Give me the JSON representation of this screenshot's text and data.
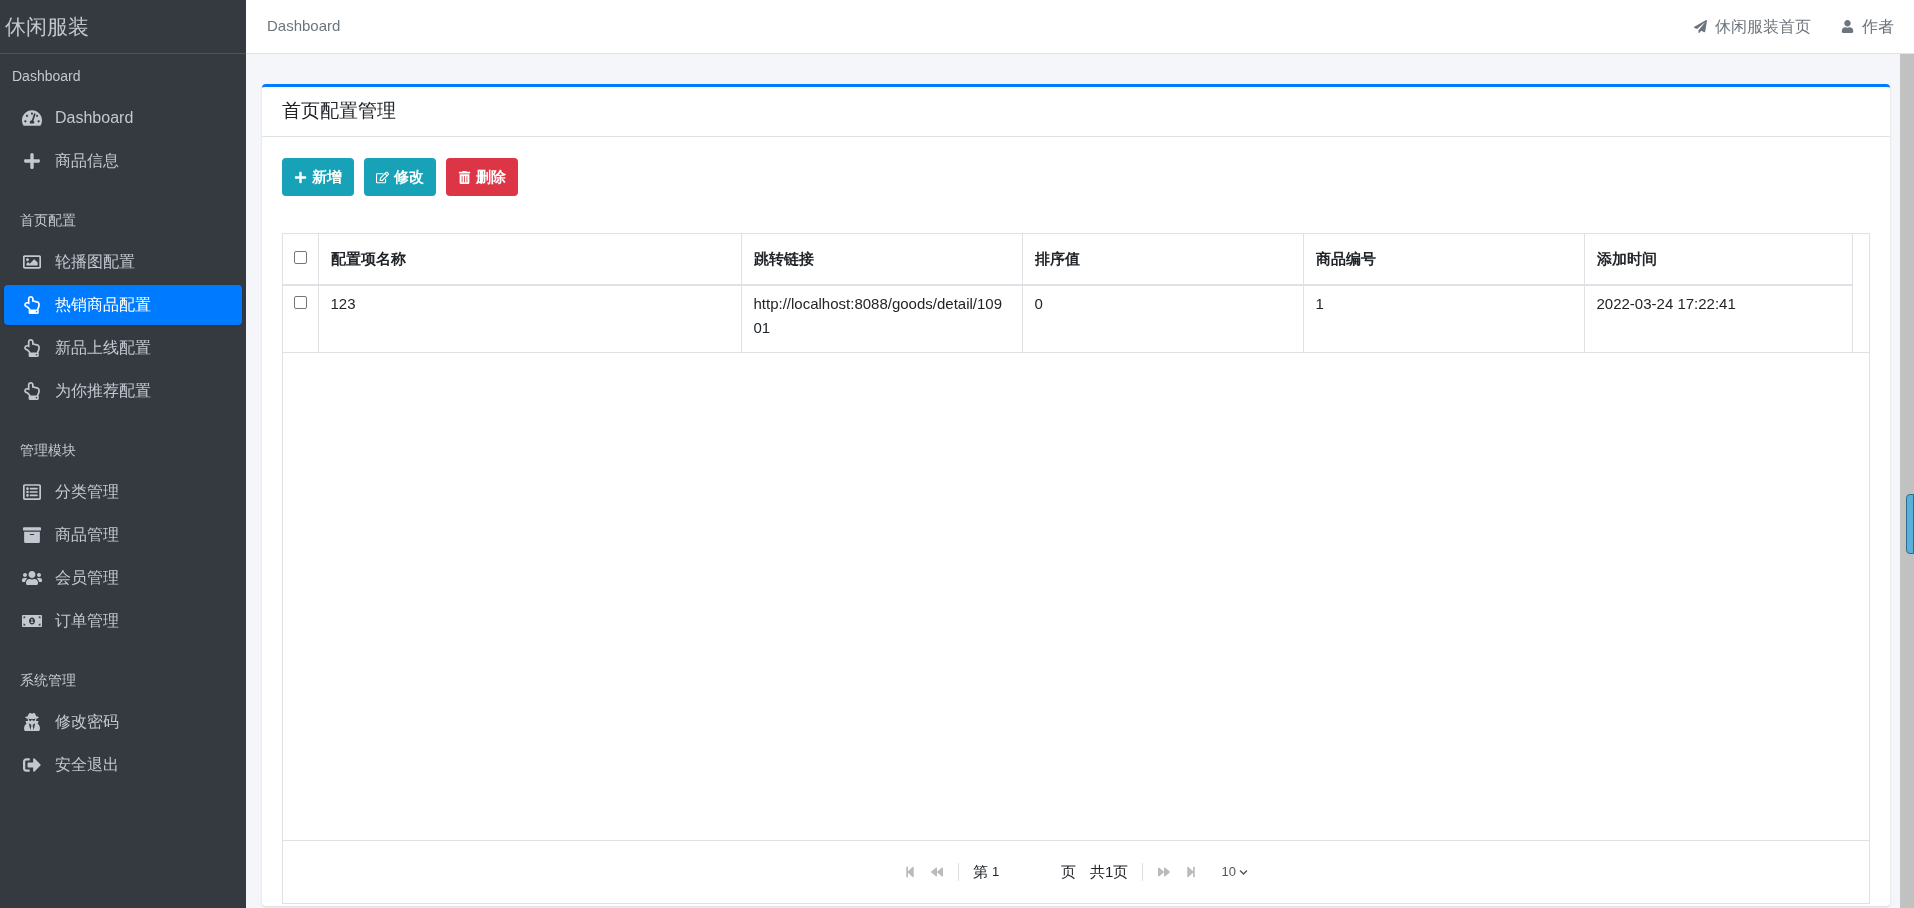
{
  "brand": "休闲服装",
  "sidebar": {
    "sections": [
      {
        "header": "Dashboard",
        "items": [
          {
            "label": "Dashboard",
            "kind": "gauge",
            "selected": false
          },
          {
            "label": "商品信息",
            "kind": "plus",
            "selected": false
          }
        ]
      },
      {
        "header": "首页配置",
        "items": [
          {
            "label": "轮播图配置",
            "kind": "image",
            "selected": false
          },
          {
            "label": "热销商品配置",
            "kind": "hand",
            "selected": true
          },
          {
            "label": "新品上线配置",
            "kind": "hand",
            "selected": false
          },
          {
            "label": "为你推荐配置",
            "kind": "hand",
            "selected": false
          }
        ]
      },
      {
        "header": "管理模块",
        "items": [
          {
            "label": "分类管理",
            "kind": "list",
            "selected": false
          },
          {
            "label": "商品管理",
            "kind": "archive",
            "selected": false
          },
          {
            "label": "会员管理",
            "kind": "users",
            "selected": false
          },
          {
            "label": "订单管理",
            "kind": "money",
            "selected": false
          }
        ]
      },
      {
        "header": "系统管理",
        "items": [
          {
            "label": "修改密码",
            "kind": "secret",
            "selected": false
          },
          {
            "label": "安全退出",
            "kind": "logout",
            "selected": false
          }
        ]
      }
    ]
  },
  "topbar": {
    "breadcrumb": "Dashboard",
    "links": [
      {
        "label": "休闲服装首页",
        "kind": "plane"
      },
      {
        "label": "作者",
        "kind": "user"
      }
    ]
  },
  "card": {
    "title": "首页配置管理",
    "buttons": [
      {
        "label": "新增",
        "kind": "add"
      },
      {
        "label": "修改",
        "kind": "edit"
      },
      {
        "label": "删除",
        "kind": "delete"
      }
    ],
    "table": {
      "select_all": false,
      "columns": [
        "配置项名称",
        "跳转链接",
        "排序值",
        "商品编号",
        "添加时间"
      ],
      "rows": [
        {
          "checked": false,
          "cells": [
            "123",
            "http://localhost:8088/goods/detail/10901",
            "0",
            "1",
            "2022-03-24 17:22:41"
          ]
        }
      ]
    },
    "pager": {
      "prefix": "第",
      "page": "1",
      "suffix": "页",
      "total": "共1页",
      "page_size": "10"
    }
  }
}
